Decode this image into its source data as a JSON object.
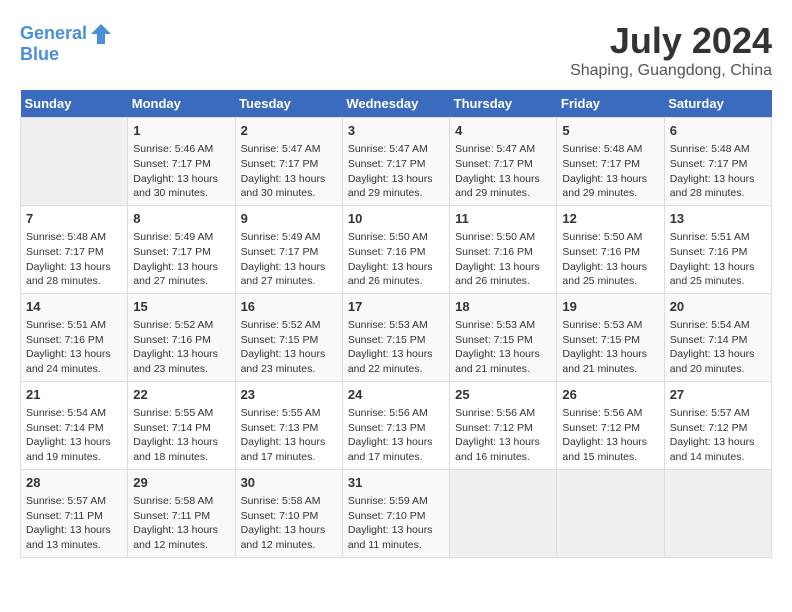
{
  "logo": {
    "line1": "General",
    "line2": "Blue"
  },
  "title": "July 2024",
  "subtitle": "Shaping, Guangdong, China",
  "header_days": [
    "Sunday",
    "Monday",
    "Tuesday",
    "Wednesday",
    "Thursday",
    "Friday",
    "Saturday"
  ],
  "weeks": [
    [
      {
        "day": "",
        "info": ""
      },
      {
        "day": "1",
        "info": "Sunrise: 5:46 AM\nSunset: 7:17 PM\nDaylight: 13 hours\nand 30 minutes."
      },
      {
        "day": "2",
        "info": "Sunrise: 5:47 AM\nSunset: 7:17 PM\nDaylight: 13 hours\nand 30 minutes."
      },
      {
        "day": "3",
        "info": "Sunrise: 5:47 AM\nSunset: 7:17 PM\nDaylight: 13 hours\nand 29 minutes."
      },
      {
        "day": "4",
        "info": "Sunrise: 5:47 AM\nSunset: 7:17 PM\nDaylight: 13 hours\nand 29 minutes."
      },
      {
        "day": "5",
        "info": "Sunrise: 5:48 AM\nSunset: 7:17 PM\nDaylight: 13 hours\nand 29 minutes."
      },
      {
        "day": "6",
        "info": "Sunrise: 5:48 AM\nSunset: 7:17 PM\nDaylight: 13 hours\nand 28 minutes."
      }
    ],
    [
      {
        "day": "7",
        "info": "Sunrise: 5:48 AM\nSunset: 7:17 PM\nDaylight: 13 hours\nand 28 minutes."
      },
      {
        "day": "8",
        "info": "Sunrise: 5:49 AM\nSunset: 7:17 PM\nDaylight: 13 hours\nand 27 minutes."
      },
      {
        "day": "9",
        "info": "Sunrise: 5:49 AM\nSunset: 7:17 PM\nDaylight: 13 hours\nand 27 minutes."
      },
      {
        "day": "10",
        "info": "Sunrise: 5:50 AM\nSunset: 7:16 PM\nDaylight: 13 hours\nand 26 minutes."
      },
      {
        "day": "11",
        "info": "Sunrise: 5:50 AM\nSunset: 7:16 PM\nDaylight: 13 hours\nand 26 minutes."
      },
      {
        "day": "12",
        "info": "Sunrise: 5:50 AM\nSunset: 7:16 PM\nDaylight: 13 hours\nand 25 minutes."
      },
      {
        "day": "13",
        "info": "Sunrise: 5:51 AM\nSunset: 7:16 PM\nDaylight: 13 hours\nand 25 minutes."
      }
    ],
    [
      {
        "day": "14",
        "info": "Sunrise: 5:51 AM\nSunset: 7:16 PM\nDaylight: 13 hours\nand 24 minutes."
      },
      {
        "day": "15",
        "info": "Sunrise: 5:52 AM\nSunset: 7:16 PM\nDaylight: 13 hours\nand 23 minutes."
      },
      {
        "day": "16",
        "info": "Sunrise: 5:52 AM\nSunset: 7:15 PM\nDaylight: 13 hours\nand 23 minutes."
      },
      {
        "day": "17",
        "info": "Sunrise: 5:53 AM\nSunset: 7:15 PM\nDaylight: 13 hours\nand 22 minutes."
      },
      {
        "day": "18",
        "info": "Sunrise: 5:53 AM\nSunset: 7:15 PM\nDaylight: 13 hours\nand 21 minutes."
      },
      {
        "day": "19",
        "info": "Sunrise: 5:53 AM\nSunset: 7:15 PM\nDaylight: 13 hours\nand 21 minutes."
      },
      {
        "day": "20",
        "info": "Sunrise: 5:54 AM\nSunset: 7:14 PM\nDaylight: 13 hours\nand 20 minutes."
      }
    ],
    [
      {
        "day": "21",
        "info": "Sunrise: 5:54 AM\nSunset: 7:14 PM\nDaylight: 13 hours\nand 19 minutes."
      },
      {
        "day": "22",
        "info": "Sunrise: 5:55 AM\nSunset: 7:14 PM\nDaylight: 13 hours\nand 18 minutes."
      },
      {
        "day": "23",
        "info": "Sunrise: 5:55 AM\nSunset: 7:13 PM\nDaylight: 13 hours\nand 17 minutes."
      },
      {
        "day": "24",
        "info": "Sunrise: 5:56 AM\nSunset: 7:13 PM\nDaylight: 13 hours\nand 17 minutes."
      },
      {
        "day": "25",
        "info": "Sunrise: 5:56 AM\nSunset: 7:12 PM\nDaylight: 13 hours\nand 16 minutes."
      },
      {
        "day": "26",
        "info": "Sunrise: 5:56 AM\nSunset: 7:12 PM\nDaylight: 13 hours\nand 15 minutes."
      },
      {
        "day": "27",
        "info": "Sunrise: 5:57 AM\nSunset: 7:12 PM\nDaylight: 13 hours\nand 14 minutes."
      }
    ],
    [
      {
        "day": "28",
        "info": "Sunrise: 5:57 AM\nSunset: 7:11 PM\nDaylight: 13 hours\nand 13 minutes."
      },
      {
        "day": "29",
        "info": "Sunrise: 5:58 AM\nSunset: 7:11 PM\nDaylight: 13 hours\nand 12 minutes."
      },
      {
        "day": "30",
        "info": "Sunrise: 5:58 AM\nSunset: 7:10 PM\nDaylight: 13 hours\nand 12 minutes."
      },
      {
        "day": "31",
        "info": "Sunrise: 5:59 AM\nSunset: 7:10 PM\nDaylight: 13 hours\nand 11 minutes."
      },
      {
        "day": "",
        "info": ""
      },
      {
        "day": "",
        "info": ""
      },
      {
        "day": "",
        "info": ""
      }
    ]
  ]
}
